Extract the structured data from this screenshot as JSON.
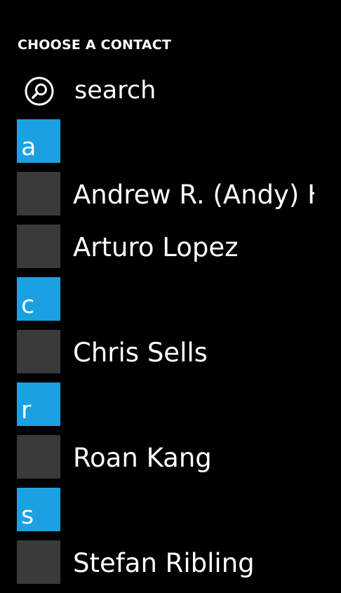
{
  "header": {
    "title": "CHOOSE A CONTACT"
  },
  "search": {
    "icon": "search-icon",
    "label": "search"
  },
  "colors": {
    "accent": "#1ba1e2",
    "avatar_placeholder": "#3a3a3a",
    "background": "#000000",
    "text": "#ffffff"
  },
  "groups": [
    {
      "letter": "a",
      "contacts": [
        "Andrew R. (Andy) Hill",
        "Arturo Lopez"
      ]
    },
    {
      "letter": "c",
      "contacts": [
        "Chris Sells"
      ]
    },
    {
      "letter": "r",
      "contacts": [
        "Roan Kang"
      ]
    },
    {
      "letter": "s",
      "contacts": [
        "Stefan Ribling"
      ]
    }
  ]
}
